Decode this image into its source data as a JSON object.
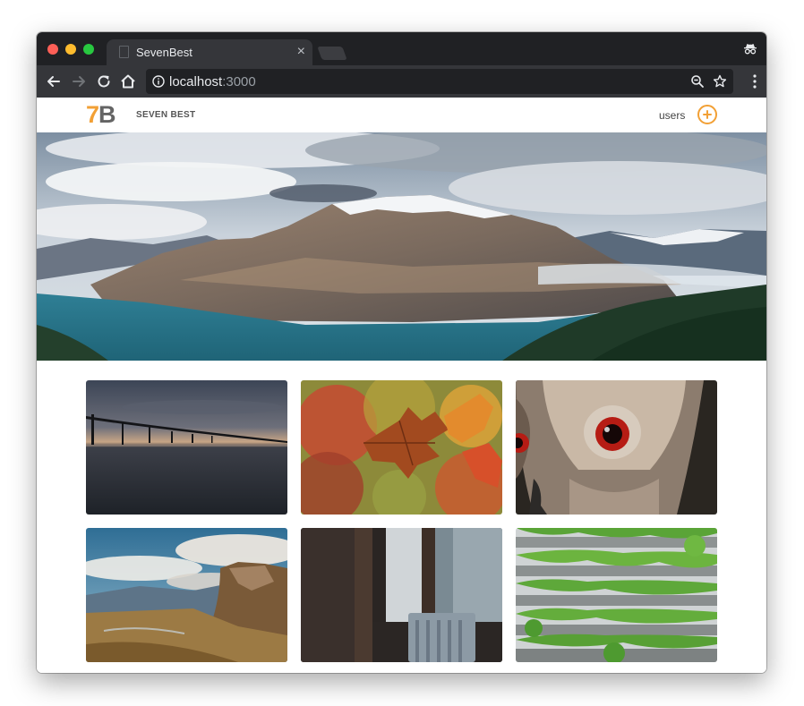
{
  "browser": {
    "tab_title": "SevenBest",
    "tab_close": "×",
    "url_host": "localhost",
    "url_port": ":3000"
  },
  "site": {
    "logo_seven": "7",
    "logo_b": "B",
    "brand_name": "SEVEN BEST",
    "nav_users": "users"
  },
  "colors": {
    "accent": "#f2a035",
    "logo_gray": "#646464"
  },
  "icons": {
    "back": "arrow-left-icon",
    "forward": "arrow-right-icon",
    "reload": "reload-icon",
    "home": "home-icon",
    "info": "info-icon",
    "zoom": "zoom-out-icon",
    "bookmark": "star-icon",
    "menu": "kebab-menu-icon",
    "incognito": "incognito-icon",
    "add": "plus-circle-icon"
  },
  "gallery": {
    "images": [
      {
        "subject": "bridge-at-dusk"
      },
      {
        "subject": "autumn-leaf"
      },
      {
        "subject": "owl-red-eyes"
      },
      {
        "subject": "mountain-valley"
      },
      {
        "subject": "window-chair"
      },
      {
        "subject": "green-terraces"
      }
    ]
  }
}
